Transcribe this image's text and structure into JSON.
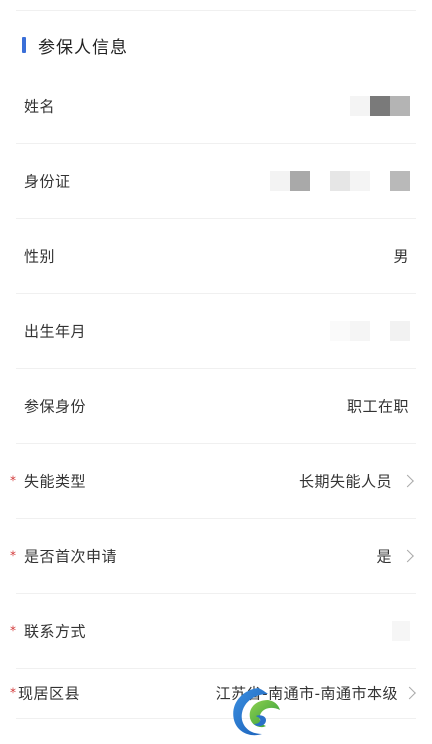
{
  "section": {
    "title": "参保人信息"
  },
  "fields": {
    "name": {
      "label": "姓名"
    },
    "id_card": {
      "label": "身份证"
    },
    "gender": {
      "label": "性别",
      "value": "男"
    },
    "birth": {
      "label": "出生年月"
    },
    "identity": {
      "label": "参保身份",
      "value": "职工在职"
    },
    "disability_type": {
      "label": "失能类型",
      "value": "长期失能人员",
      "required_mark": "*"
    },
    "first_application": {
      "label": "是否首次申请",
      "value": "是",
      "required_mark": "*"
    },
    "contact": {
      "label": "联系方式",
      "required_mark": "*"
    },
    "county": {
      "label": "现居区县",
      "value": "江苏省-南通市-南通市本级",
      "required_mark": "*"
    }
  },
  "colors": {
    "accent": "#3a6fd8",
    "required": "#d33a3a"
  },
  "icons": {
    "chevron": "chevron-right-icon",
    "logo": "app-logo-icon"
  }
}
